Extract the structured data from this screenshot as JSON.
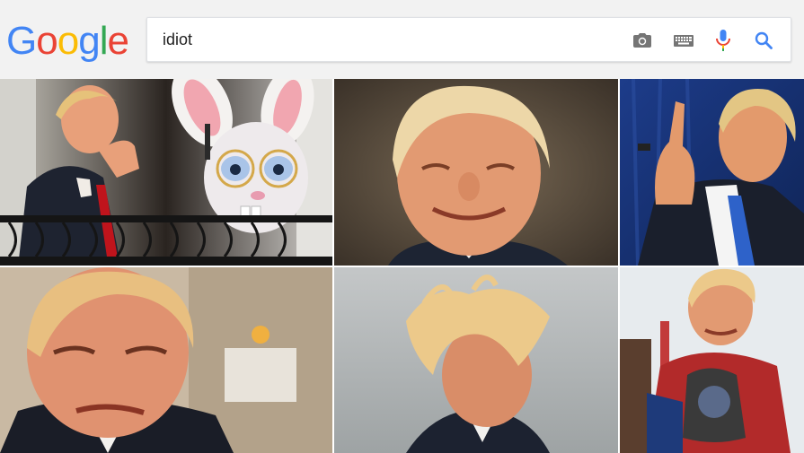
{
  "logo": {
    "letters": [
      "G",
      "o",
      "o",
      "g",
      "l",
      "e"
    ],
    "colors": [
      "#4285F4",
      "#EA4335",
      "#FBBC05",
      "#4285F4",
      "#34A853",
      "#EA4335"
    ]
  },
  "search": {
    "query": "idiot",
    "icons": [
      "camera-icon",
      "keyboard-icon",
      "microphone-icon",
      "search-icon"
    ]
  },
  "results": {
    "images": [
      {
        "id": "result-image-1",
        "desc_icon": "photo"
      },
      {
        "id": "result-image-2",
        "desc_icon": "photo"
      },
      {
        "id": "result-image-3",
        "desc_icon": "photo"
      },
      {
        "id": "result-image-4",
        "desc_icon": "photo"
      },
      {
        "id": "result-image-5",
        "desc_icon": "photo"
      },
      {
        "id": "result-image-6",
        "desc_icon": "photo"
      }
    ]
  },
  "colors": {
    "header_bg": "#f2f2f2",
    "search_blue": "#4285F4",
    "mic_red": "#EA4335",
    "icon_gray": "#757575"
  }
}
